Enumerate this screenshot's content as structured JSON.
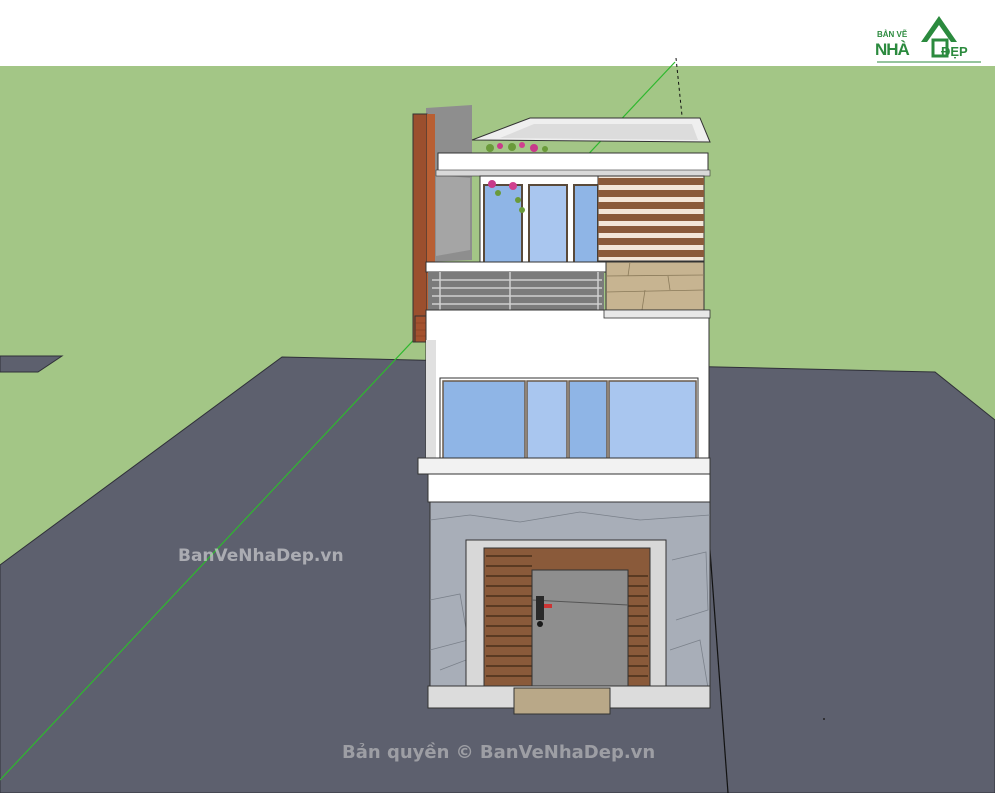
{
  "watermarks": {
    "middle": "BanVeNhaDep.vn",
    "bottom": "Bản quyền © BanVeNhaDep.vn"
  },
  "logo": {
    "top_text": "BẢN VẼ",
    "brand_left": "NHÀ",
    "brand_right": "ĐẸP"
  },
  "colors": {
    "sky": "#ffffff",
    "grass": "#a3c686",
    "road": "#5d606e",
    "brand_green": "#2b8a3e",
    "axis_green": "#2eb82e"
  }
}
